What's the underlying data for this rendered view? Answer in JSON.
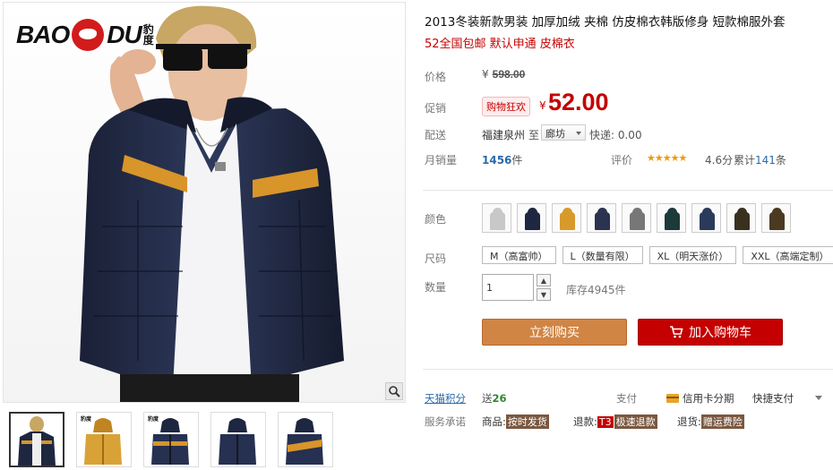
{
  "gallery": {
    "brand_word_left": "BAO",
    "brand_word_right": "DU",
    "brand_cn": "豹度",
    "thumb_brand": "豹度"
  },
  "product": {
    "title": "2013冬装新款男装 加厚加绒 夹棉 仿皮棉衣韩版修身 短款棉服外套",
    "subtitle": "52全国包邮 默认申通 皮棉衣"
  },
  "price": {
    "label": "价格",
    "currency": "¥",
    "original": "598.00",
    "promo_label": "促销",
    "promo_tag": "购物狂欢",
    "promo_price": "52.00"
  },
  "shipping": {
    "label": "配送",
    "from": "福建泉州",
    "to": "至",
    "destination": "廊坊",
    "fee": "快递: 0.00"
  },
  "sales": {
    "label": "月销量",
    "count": "1456",
    "unit": "件",
    "rating_label": "评价",
    "stars": "★★★★★",
    "score": "4.6分",
    "reviews_prefix": "累计",
    "reviews_count": "141",
    "reviews_suffix": "条"
  },
  "options": {
    "color_label": "颜色",
    "colors": [
      "#c8c8c8",
      "#1e2740",
      "#d79a2a",
      "#2a3350",
      "#777777",
      "#1c3a3a",
      "#2a3a5a",
      "#3a3020",
      "#4a3a22"
    ],
    "size_label": "尺码",
    "sizes": [
      "M（高富帅）",
      "L（数量有限）",
      "XL（明天涨价）",
      "XXL（高端定制）"
    ],
    "qty_label": "数量",
    "qty_value": "1",
    "stock": "库存4945件"
  },
  "actions": {
    "buy_now": "立刻购买",
    "add_to_cart": "加入购物车"
  },
  "payment": {
    "points_label": "天猫积分",
    "points_prefix": "送",
    "points_value": "26",
    "pay_label": "支付",
    "credit": "信用卡分期",
    "quickpay": "快捷支付"
  },
  "service": {
    "label": "服务承诺",
    "goods_prefix": "商品:",
    "goods_tag": "按时发货",
    "refund_prefix": "退款:",
    "refund_t3": "T3",
    "refund_tag": "极速退款",
    "return_prefix": "退货:",
    "return_tag": "赠运费险"
  }
}
